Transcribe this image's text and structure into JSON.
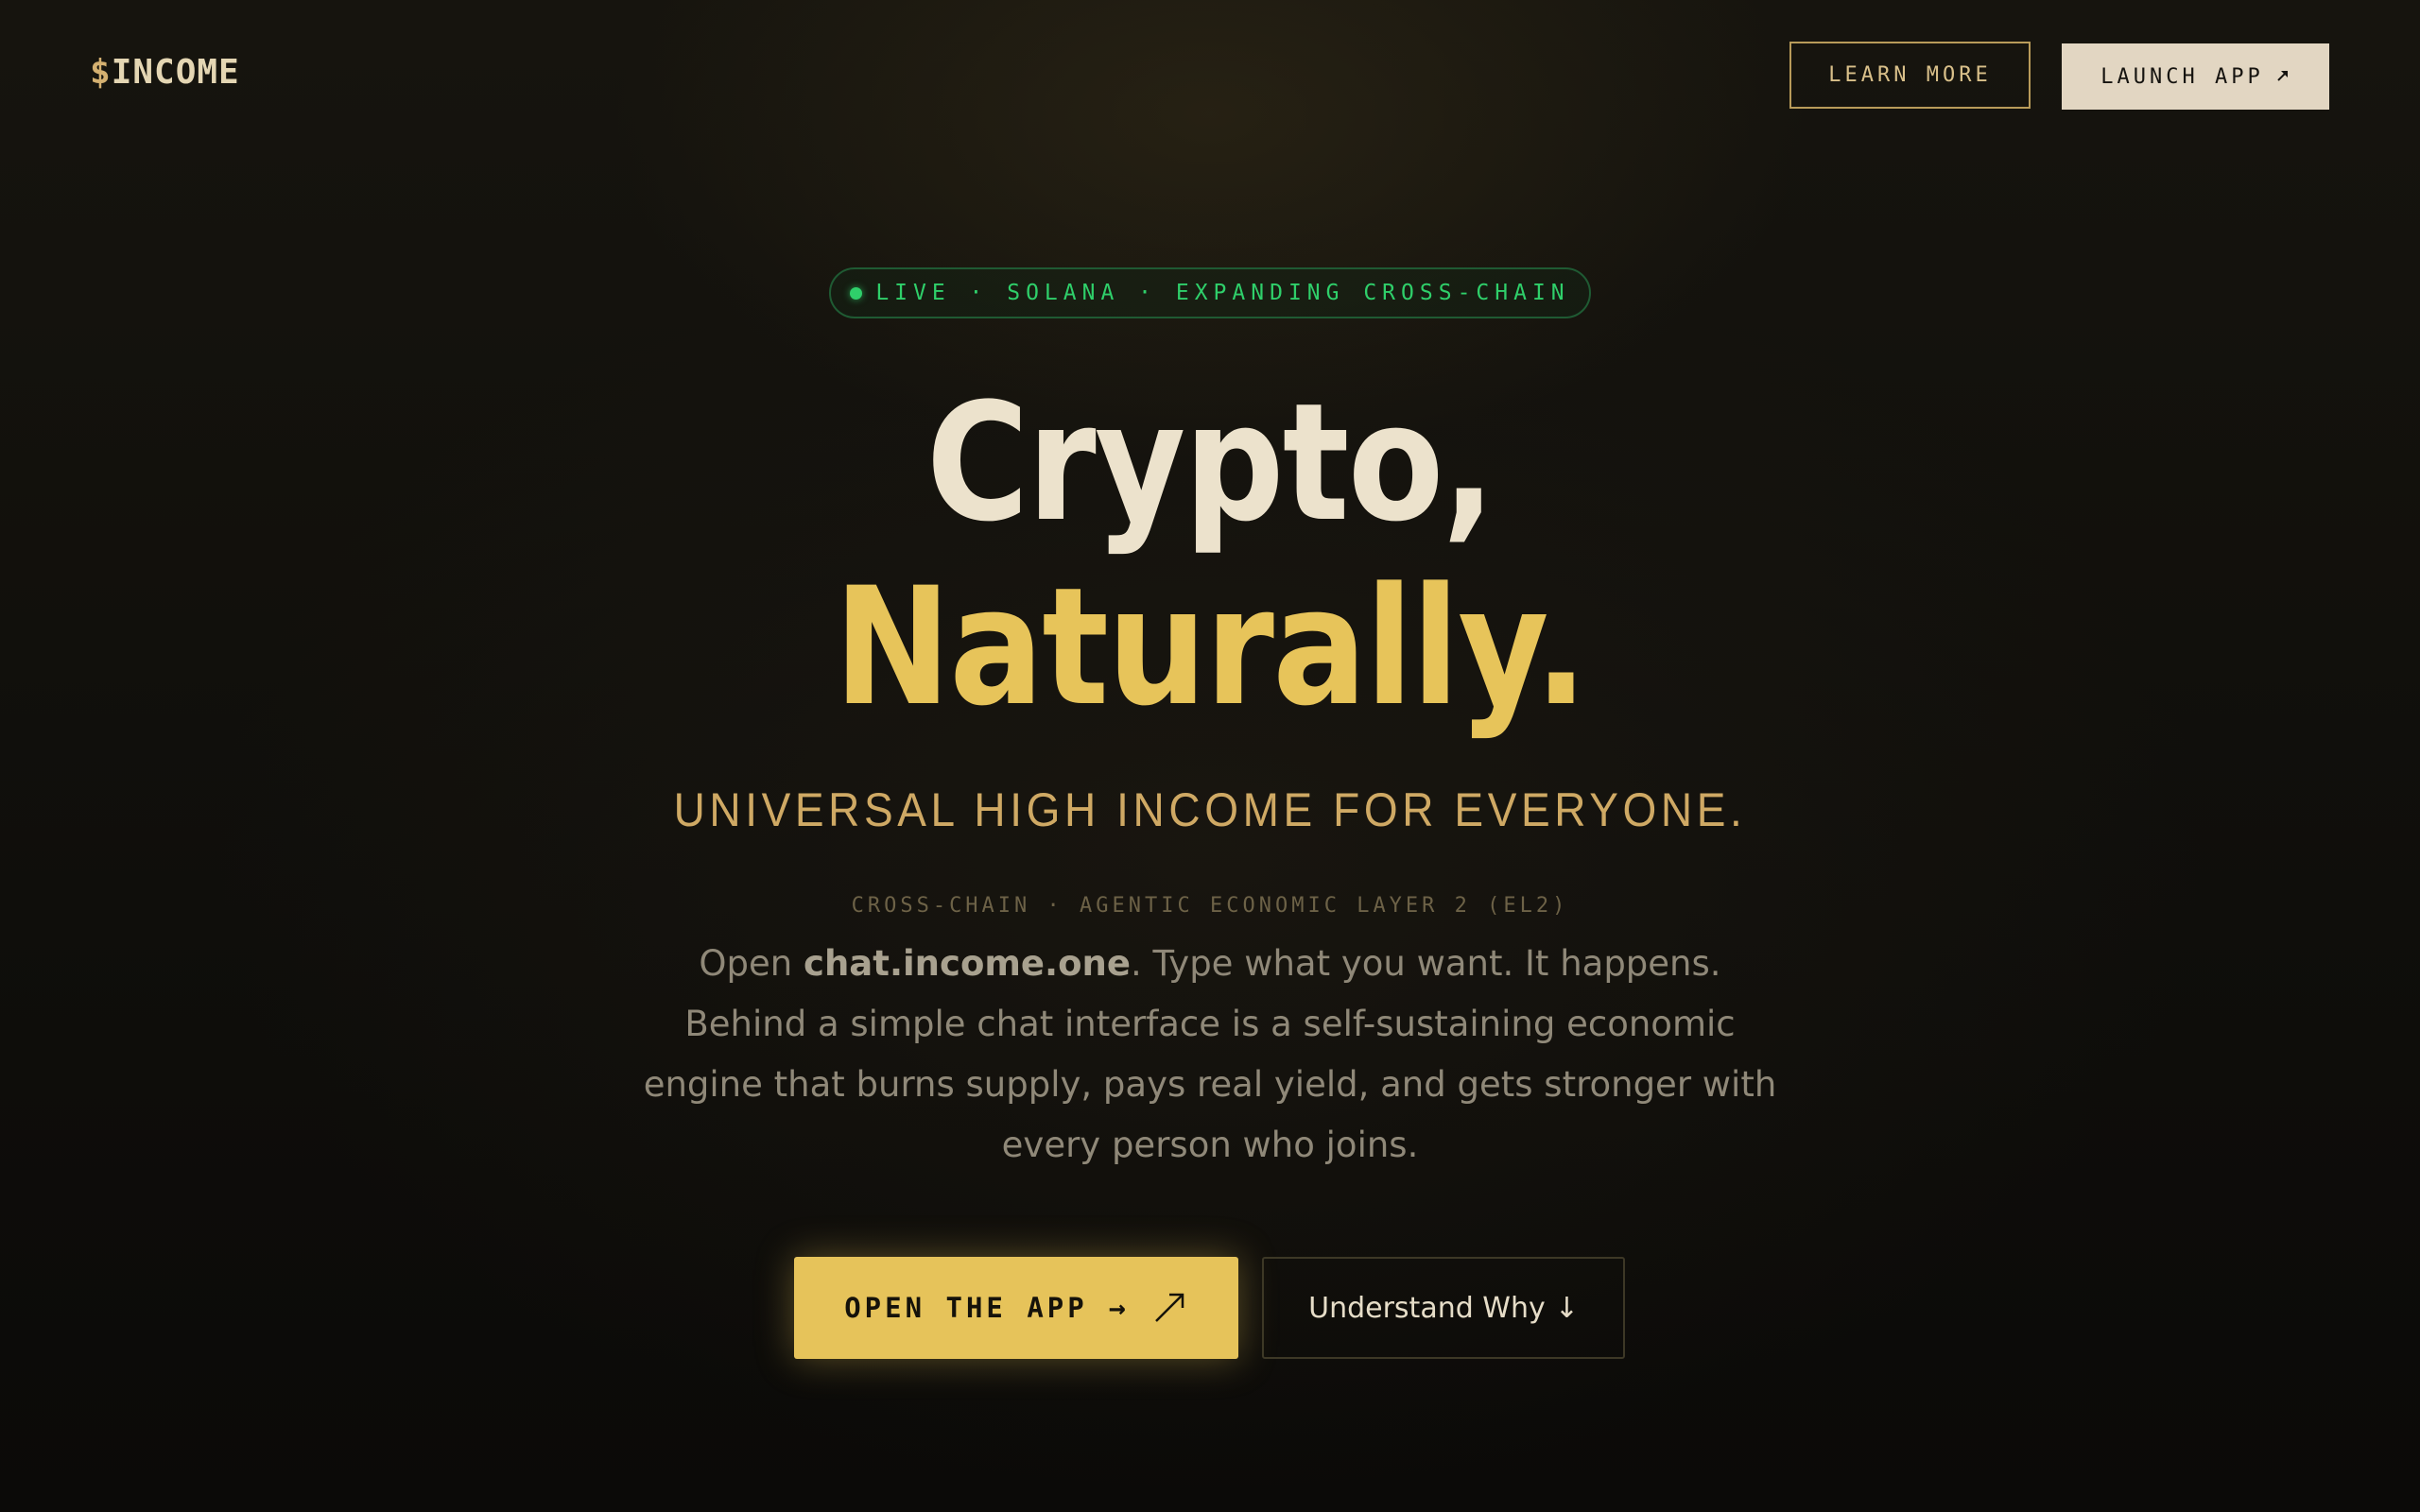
{
  "nav": {
    "logo_symbol": "$",
    "logo_text": "INCOME",
    "learn_more_label": "LEARN MORE",
    "launch_app_label": "LAUNCH APP",
    "launch_app_icon": "arrow-up-right-icon"
  },
  "hero": {
    "status_badge": "LIVE · SOLANA · EXPANDING CROSS-CHAIN",
    "status_color": "#2fcf6a",
    "headline_line1": "Crypto,",
    "headline_line2": "Naturally.",
    "tagline": "UNIVERSAL HIGH INCOME FOR EVERYONE.",
    "kicker": "CROSS-CHAIN · AGENTIC ECONOMIC LAYER 2 (EL2)",
    "description_prefix": "Open ",
    "description_link": "chat.income.one",
    "description_suffix": ". Type what you want. It happens. Behind a simple chat interface is a self-sustaining economic engine that burns supply, pays real yield, and gets stronger with every person who joins."
  },
  "cta": {
    "primary_label": "OPEN THE APP",
    "primary_arrow": "→",
    "secondary_label": "Understand Why",
    "secondary_arrow": "↓"
  },
  "colors": {
    "accent": "#e6c35a",
    "background": "#100f0b",
    "headline": "#ece2cc",
    "tagline": "#cfa964"
  }
}
